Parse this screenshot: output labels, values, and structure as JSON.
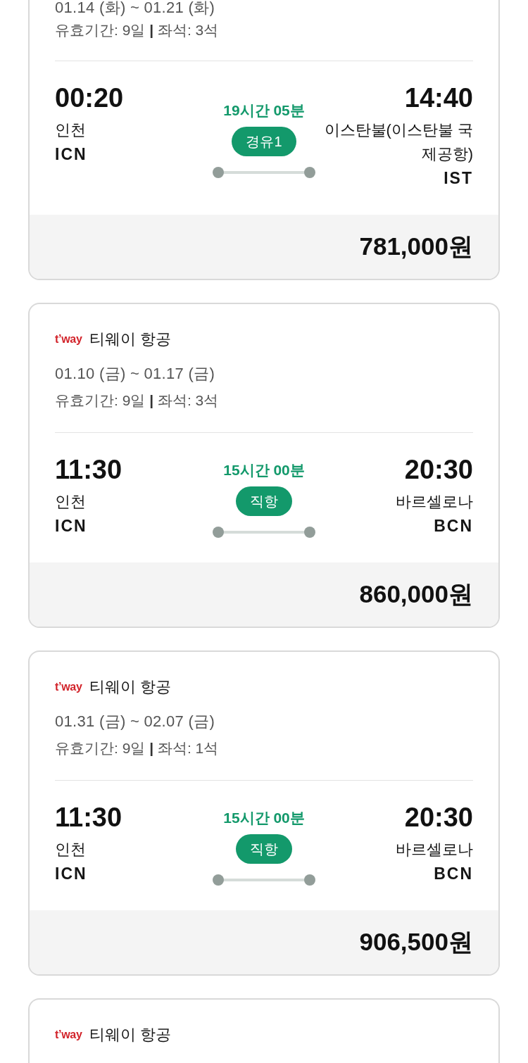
{
  "flights": [
    {
      "dates": "01.14 (화) ~ 01.21 (화)",
      "validity": "유효기간: 9일 **|** 좌석: 3석",
      "departure": {
        "time": "00:20",
        "city": "인천",
        "code": "ICN"
      },
      "duration": "19시간 05분",
      "stops": "경유1",
      "arrival": {
        "time": "14:40",
        "city": "이스탄불(이스탄불 국제공항)",
        "code": "IST"
      },
      "price": "781,000원"
    },
    {
      "airline": {
        "logo": "t’way",
        "name": "티웨이 항공"
      },
      "dates": "01.10 (금) ~ 01.17 (금)",
      "validity": "유효기간: 9일 **|** 좌석: 3석",
      "departure": {
        "time": "11:30",
        "city": "인천",
        "code": "ICN"
      },
      "duration": "15시간 00분",
      "stops": "직항",
      "arrival": {
        "time": "20:30",
        "city": "바르셀로나",
        "code": "BCN"
      },
      "price": "860,000원"
    },
    {
      "airline": {
        "logo": "t’way",
        "name": "티웨이 항공"
      },
      "dates": "01.31 (금) ~ 02.07 (금)",
      "validity": "유효기간: 9일 **|** 좌석: 1석",
      "departure": {
        "time": "11:30",
        "city": "인천",
        "code": "ICN"
      },
      "duration": "15시간 00분",
      "stops": "직항",
      "arrival": {
        "time": "20:30",
        "city": "바르셀로나",
        "code": "BCN"
      },
      "price": "906,500원"
    },
    {
      "airline": {
        "logo": "t’way",
        "name": "티웨이 항공"
      }
    }
  ]
}
